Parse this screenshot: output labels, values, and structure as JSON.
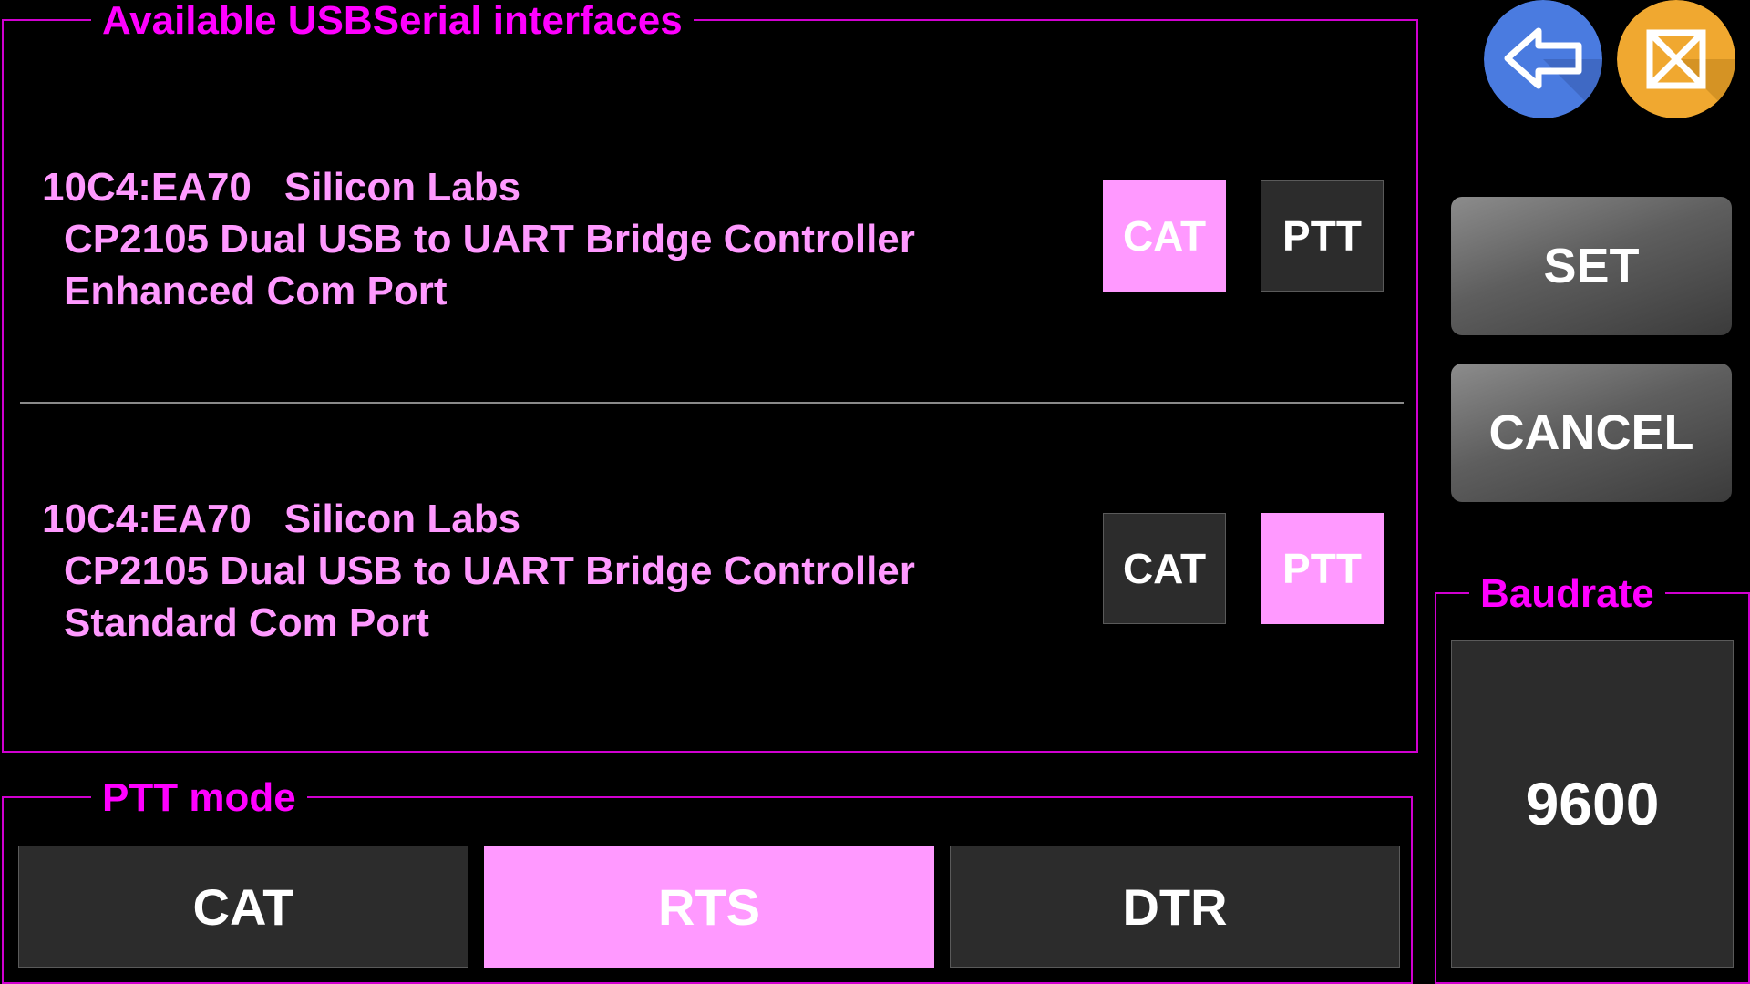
{
  "usb_panel": {
    "title": "Available USBSerial interfaces",
    "devices": [
      {
        "vid_pid": "10C4:EA70",
        "vendor": "Silicon Labs",
        "product": "CP2105 Dual USB to UART Bridge Controller",
        "interface": "Enhanced Com Port",
        "cat_label": "CAT",
        "ptt_label": "PTT",
        "selected": "CAT"
      },
      {
        "vid_pid": "10C4:EA70",
        "vendor": "Silicon Labs",
        "product": "CP2105 Dual USB to UART Bridge Controller",
        "interface": "Standard Com Port",
        "cat_label": "CAT",
        "ptt_label": "PTT",
        "selected": "PTT"
      }
    ]
  },
  "ptt_mode": {
    "title": "PTT mode",
    "options": [
      "CAT",
      "RTS",
      "DTR"
    ],
    "selected": "RTS"
  },
  "actions": {
    "set_label": "SET",
    "cancel_label": "CANCEL"
  },
  "baudrate": {
    "title": "Baudrate",
    "value": "9600"
  },
  "top_icons": {
    "back": "back-arrow-icon",
    "close": "close-box-icon"
  },
  "colors": {
    "accent_magenta": "#ff00ff",
    "selected_pink": "#ff99ff",
    "back_blue": "#4a7be0",
    "close_orange": "#f0a830"
  }
}
